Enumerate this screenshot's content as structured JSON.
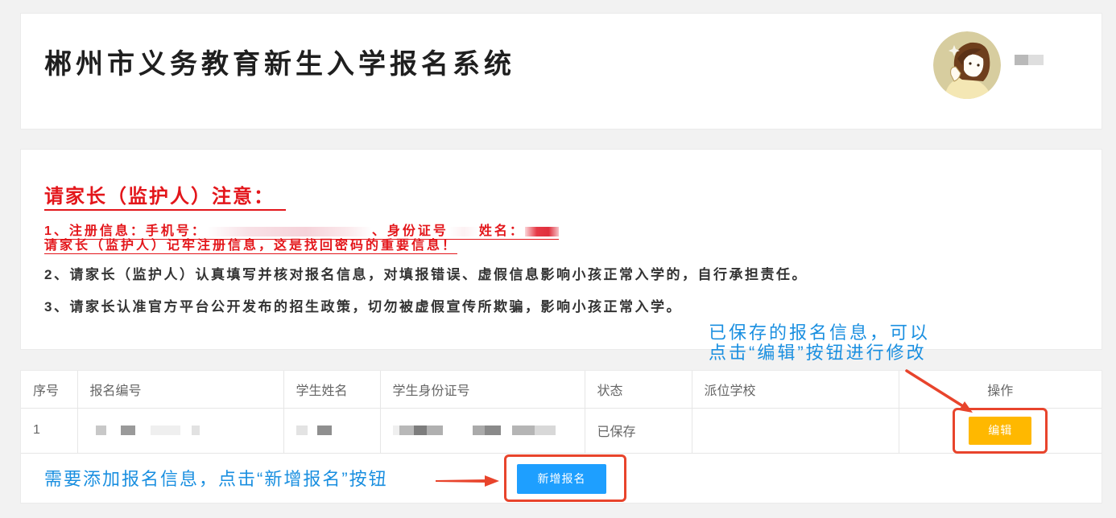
{
  "header": {
    "title": "郴州市义务教育新生入学报名系统"
  },
  "notice": {
    "heading": "请家长（监护人）注意：",
    "item1": {
      "phone_label": "1、注册信息：手机号：",
      "id_label": "、身份证号",
      "name_label": "姓名：",
      "reminder": "请家长（监护人）记牢注册信息，这是找回密码的重要信息！"
    },
    "item2": "2、请家长（监护人）认真填写并核对报名信息，对填报错误、虚假信息影响小孩正常入学的，自行承担责任。",
    "item3": "3、请家长认准官方平台公开发布的招生政策，切勿被虚假宣传所欺骗，影响小孩正常入学。"
  },
  "annotations": {
    "edit_hint": [
      "已保存的报名信息，可以",
      "点击“编辑”按钮进行修改"
    ],
    "add_hint": "需要添加报名信息，点击“新增报名”按钮"
  },
  "table": {
    "columns": [
      "序号",
      "报名编号",
      "学生姓名",
      "学生身份证号",
      "状态",
      "派位学校",
      "操作"
    ],
    "rows": [
      {
        "index": "1",
        "status": "已保存",
        "action": "编辑"
      }
    ]
  },
  "toolbar": {
    "add_label": "新增报名"
  },
  "icons": {
    "edit_arrow": "arrow-down-right-icon",
    "add_arrow": "arrow-right-icon"
  },
  "colors": {
    "page_bg": "#f2f2f2",
    "notice_red": "#e3161b",
    "hint_blue": "#1a8fe0",
    "edit_button": "#ffb800",
    "add_button": "#1e9fff",
    "highlight_red": "#e8442c"
  }
}
